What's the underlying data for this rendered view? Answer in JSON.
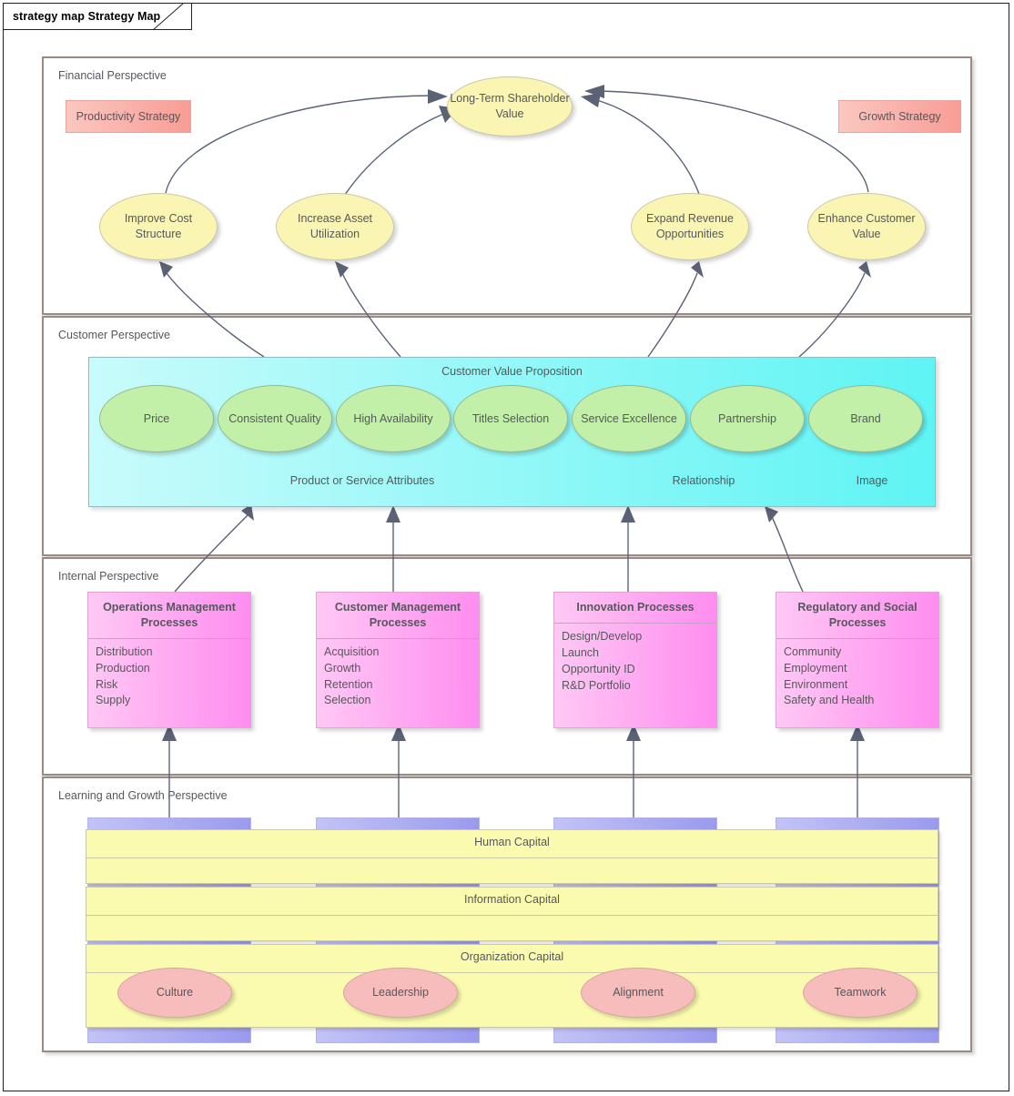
{
  "diagram": {
    "frame_title": "strategy map Strategy Map",
    "type": "strategy-map"
  },
  "colors": {
    "frame_border": "#222222",
    "perspective_border": "#9b8984",
    "financial_node": "#fbf5b4",
    "strategy_box": "#f79d95",
    "cvp_panel": "#5ff4f4",
    "cvp_node": "#c3f0a8",
    "process_box": "#ff8df0",
    "capital_band": "#fbfbb0",
    "capital_column": "#9a9aee",
    "org_node": "#f7bdbd",
    "connector": "#5b6276",
    "text": "#55585c"
  },
  "perspectives": [
    {
      "id": "financial",
      "label": "Financial Perspective"
    },
    {
      "id": "customer",
      "label": "Customer Perspective"
    },
    {
      "id": "internal",
      "label": "Internal Perspective"
    },
    {
      "id": "learning",
      "label": "Learning and Growth Perspective"
    }
  ],
  "financial": {
    "strategy_left": "Productivity Strategy",
    "strategy_right": "Growth Strategy",
    "top_goal": "Long-Term Shareholder Value",
    "objectives": [
      "Improve Cost Structure",
      "Increase Asset Utilization",
      "Expand Revenue Opportunities",
      "Enhance Customer Value"
    ]
  },
  "customer": {
    "panel_title": "Customer Value Proposition",
    "attributes": [
      "Price",
      "Consistent Quality",
      "High Availability",
      "Titles Selection",
      "Service Excellence",
      "Partnership",
      "Brand"
    ],
    "group_labels": [
      "Product or Service Attributes",
      "Relationship",
      "Image"
    ]
  },
  "internal": {
    "processes": [
      {
        "title": "Operations Management Processes",
        "items": [
          "Distribution",
          "Production",
          "Risk",
          "Supply"
        ]
      },
      {
        "title": "Customer Management Processes",
        "items": [
          "Acquisition",
          "Growth",
          "Retention",
          "Selection"
        ]
      },
      {
        "title": "Innovation Processes",
        "items": [
          "Design/Develop",
          "Launch",
          "Opportunity ID",
          "R&D Portfolio"
        ]
      },
      {
        "title": "Regulatory and Social Processes",
        "items": [
          "Community",
          "Employment",
          "Environment",
          "Safety and Health"
        ]
      }
    ]
  },
  "learning": {
    "bands": [
      "Human Capital",
      "Information Capital",
      "Organization Capital"
    ],
    "organization_nodes": [
      "Culture",
      "Leadership",
      "Alignment",
      "Teamwork"
    ]
  }
}
